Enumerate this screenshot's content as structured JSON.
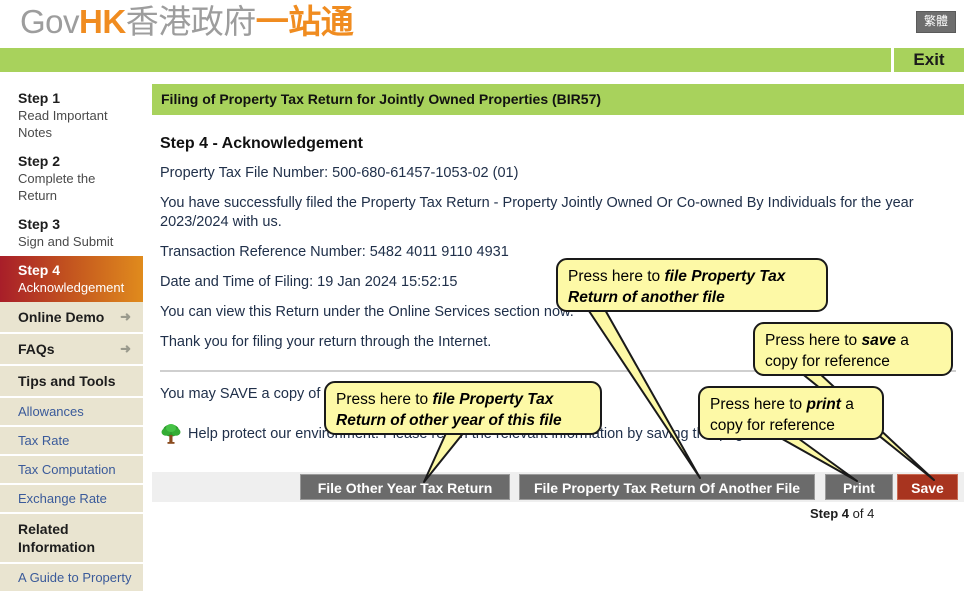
{
  "header": {
    "logo": {
      "gov": "Gov",
      "hk": "HK",
      "cn_grey": "香港政府",
      "cn_orange": "一站通"
    },
    "language_toggle": "繁體",
    "exit_label": "Exit"
  },
  "sidebar": {
    "steps": [
      {
        "title": "Step 1",
        "sub": "Read Important Notes",
        "active": false
      },
      {
        "title": "Step 2",
        "sub": "Complete the Return",
        "active": false
      },
      {
        "title": "Step 3",
        "sub": "Sign and Submit",
        "active": false
      },
      {
        "title": "Step 4",
        "sub": "Acknowledgement",
        "active": true
      }
    ],
    "links": [
      {
        "label": "Online Demo",
        "arrow": "➜"
      },
      {
        "label": "FAQs",
        "arrow": "➜"
      }
    ],
    "tips_heading": "Tips and Tools",
    "tips_items": [
      "Allowances",
      "Tax Rate",
      "Tax Computation",
      "Exchange Rate"
    ],
    "related_heading": "Related Information",
    "related_items": [
      "A Guide to Property"
    ]
  },
  "main": {
    "banner": "Filing of Property Tax Return for Jointly Owned Properties (BIR57)",
    "step_title": "Step 4  -  Acknowledgement",
    "file_number_line": "Property Tax File Number: 500-680-61457-1053-02 (01)",
    "success_line": "You have successfully filed the Property Tax Return - Property Jointly Owned Or Co-owned By Individuals for the year 2023/2024 with us.",
    "transaction_line": "Transaction Reference Number: 5482 4011 9110 4931",
    "datetime_line": "Date and Time of Filing: 19 Jan 2024 15:52:15",
    "view_line": "You can view this Return under the Online Services section now.",
    "thanks_line": "Thank you for filing your return through the Internet.",
    "save_copy_line": "You may SAVE a copy of this page for future reference.",
    "eco_line": "Help protect our environment. Please retain the relevant information by saving this page.",
    "tree_icon": "tree-icon"
  },
  "buttons": {
    "file_other_year": "File Other Year Tax Return",
    "file_another_file": "File Property Tax Return Of Another File",
    "print": "Print",
    "save": "Save"
  },
  "step_counter": {
    "bold": "Step 4",
    "rest": " of 4"
  },
  "callouts": {
    "another_file": {
      "pre": "Press here to ",
      "em": "file Property Tax Return of another file",
      "post": ""
    },
    "save": {
      "pre": "Press here to ",
      "em": "save",
      "post": " a copy for reference"
    },
    "other_year": {
      "pre": "Press here to ",
      "em": "file Property Tax Return of other year of this file",
      "post": ""
    },
    "print": {
      "pre": "Press here to ",
      "em": "print",
      "post": " a copy for reference"
    }
  },
  "colors": {
    "nav_green": "#a8d25c",
    "accent_orange": "#f08c20",
    "active_step_start": "#a81e29",
    "active_step_end": "#e08b1d",
    "sidebar_bg": "#e9e4d0",
    "callout_yellow": "#fdf9a6",
    "save_button_red": "#a8341f",
    "button_grey": "#6b6b6b"
  }
}
